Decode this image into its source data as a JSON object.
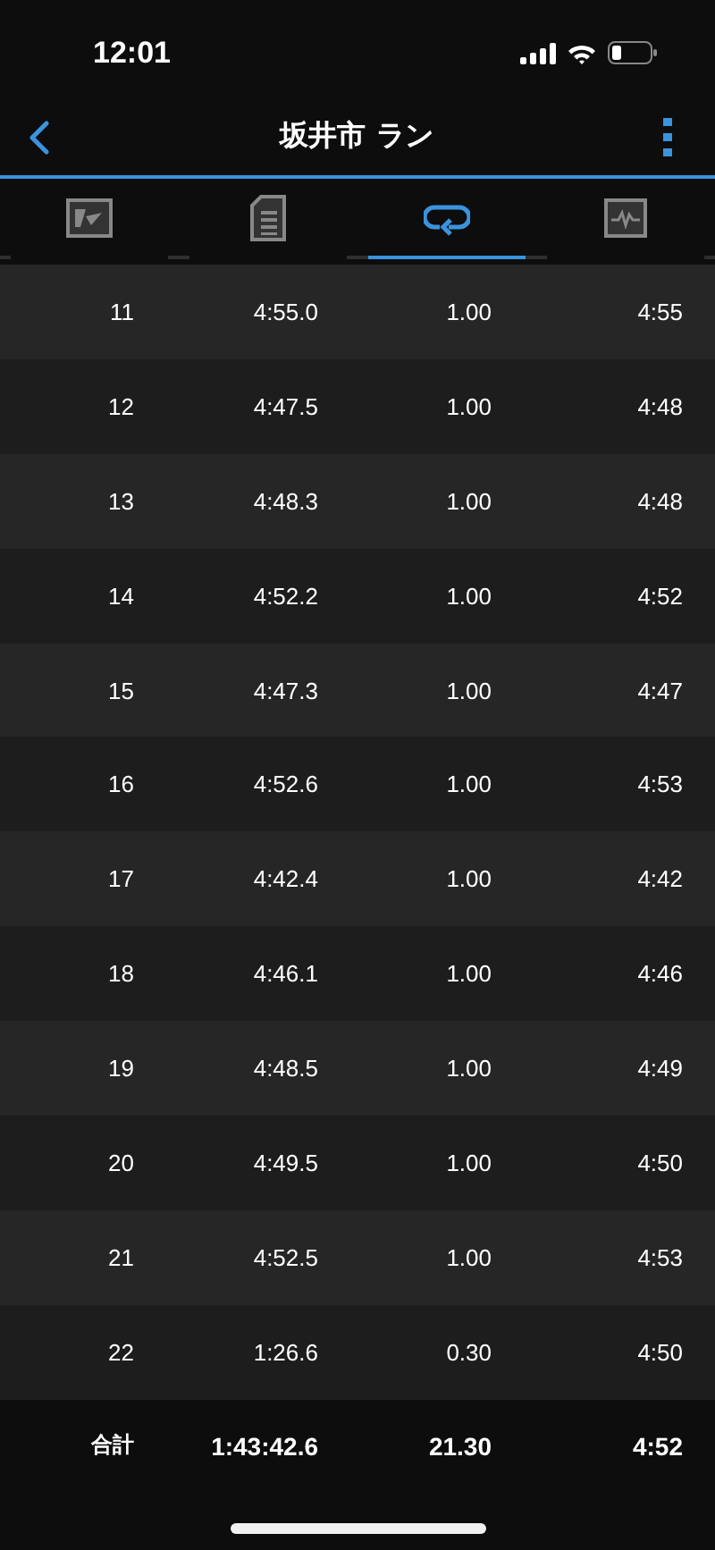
{
  "status_bar": {
    "time": "12:01"
  },
  "nav": {
    "title": "坂井市 ラン"
  },
  "tabs": [
    {
      "kind": "summary",
      "selected": false
    },
    {
      "kind": "details",
      "selected": false
    },
    {
      "kind": "laps",
      "selected": true
    },
    {
      "kind": "chart",
      "selected": false
    }
  ],
  "laps": [
    {
      "lap": "11",
      "time": "4:55.0",
      "distance": "1.00",
      "pace": "4:55"
    },
    {
      "lap": "12",
      "time": "4:47.5",
      "distance": "1.00",
      "pace": "4:48"
    },
    {
      "lap": "13",
      "time": "4:48.3",
      "distance": "1.00",
      "pace": "4:48"
    },
    {
      "lap": "14",
      "time": "4:52.2",
      "distance": "1.00",
      "pace": "4:52"
    },
    {
      "lap": "15",
      "time": "4:47.3",
      "distance": "1.00",
      "pace": "4:47"
    },
    {
      "lap": "16",
      "time": "4:52.6",
      "distance": "1.00",
      "pace": "4:53"
    },
    {
      "lap": "17",
      "time": "4:42.4",
      "distance": "1.00",
      "pace": "4:42"
    },
    {
      "lap": "18",
      "time": "4:46.1",
      "distance": "1.00",
      "pace": "4:46"
    },
    {
      "lap": "19",
      "time": "4:48.5",
      "distance": "1.00",
      "pace": "4:49"
    },
    {
      "lap": "20",
      "time": "4:49.5",
      "distance": "1.00",
      "pace": "4:50"
    },
    {
      "lap": "21",
      "time": "4:52.5",
      "distance": "1.00",
      "pace": "4:53"
    },
    {
      "lap": "22",
      "time": "1:26.6",
      "distance": "0.30",
      "pace": "4:50"
    }
  ],
  "total": {
    "label": "合計",
    "time": "1:43:42.6",
    "distance": "21.30",
    "pace": "4:52"
  }
}
